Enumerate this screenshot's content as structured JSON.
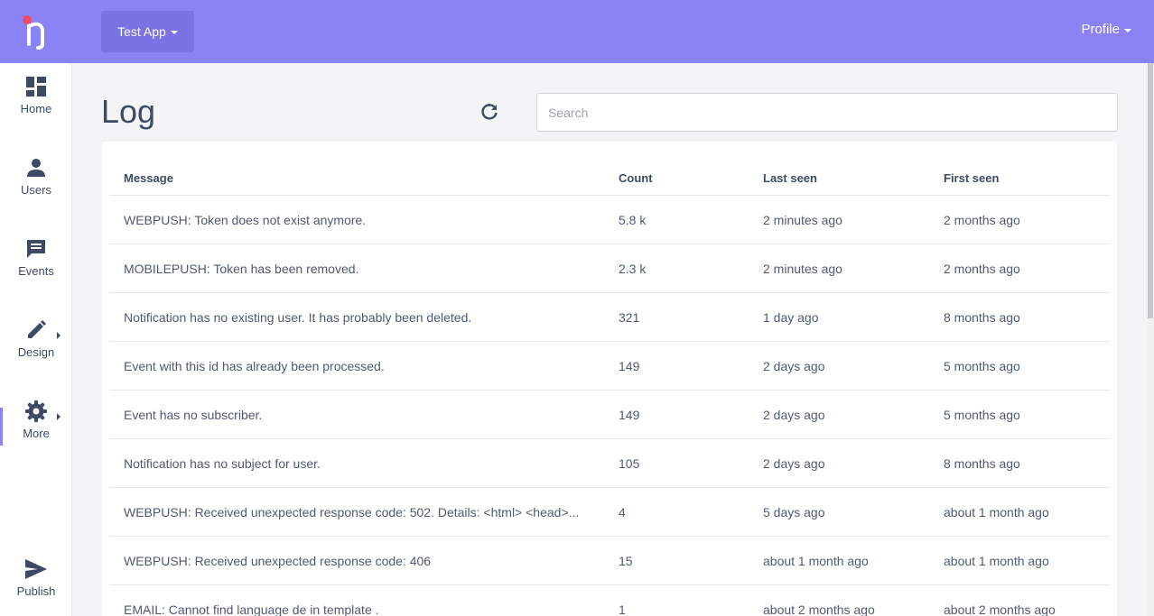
{
  "sidebar": {
    "items": [
      {
        "label": "Home",
        "icon": "dashboard-icon"
      },
      {
        "label": "Users",
        "icon": "person-icon"
      },
      {
        "label": "Events",
        "icon": "chat-icon"
      },
      {
        "label": "Design",
        "icon": "pencil-icon"
      },
      {
        "label": "More",
        "icon": "gear-icon"
      },
      {
        "label": "Publish",
        "icon": "send-icon"
      }
    ]
  },
  "header": {
    "app_name": "Test App",
    "profile_label": "Profile"
  },
  "main": {
    "title": "Log",
    "search_placeholder": "Search",
    "columns": [
      "Message",
      "Count",
      "Last seen",
      "First seen"
    ],
    "rows": [
      {
        "message": "WEBPUSH: Token does not exist anymore.",
        "count": "5.8 k",
        "last_seen": "2 minutes ago",
        "first_seen": "2 months ago"
      },
      {
        "message": "MOBILEPUSH: Token has been removed.",
        "count": "2.3 k",
        "last_seen": "2 minutes ago",
        "first_seen": "2 months ago"
      },
      {
        "message": "Notification has no existing user. It has probably been deleted.",
        "count": "321",
        "last_seen": "1 day ago",
        "first_seen": "8 months ago"
      },
      {
        "message": "Event with this id has already been processed.",
        "count": "149",
        "last_seen": "2 days ago",
        "first_seen": "5 months ago"
      },
      {
        "message": "Event has no subscriber.",
        "count": "149",
        "last_seen": "2 days ago",
        "first_seen": "5 months ago"
      },
      {
        "message": "Notification has no subject for user.",
        "count": "105",
        "last_seen": "2 days ago",
        "first_seen": "8 months ago"
      },
      {
        "message": "WEBPUSH: Received unexpected response code: 502. Details: <html> <head>...",
        "count": "4",
        "last_seen": "5 days ago",
        "first_seen": "about 1 month ago"
      },
      {
        "message": "WEBPUSH: Received unexpected response code: 406",
        "count": "15",
        "last_seen": "about 1 month ago",
        "first_seen": "about 1 month ago"
      },
      {
        "message": "EMAIL: Cannot find language de in template .",
        "count": "1",
        "last_seen": "about 2 months ago",
        "first_seen": "about 2 months ago"
      }
    ]
  },
  "colors": {
    "brand": "#8a83f5",
    "brand_dark": "#7a73e6",
    "text": "#3e4a63",
    "logo_dot": "#ef4d5f"
  }
}
